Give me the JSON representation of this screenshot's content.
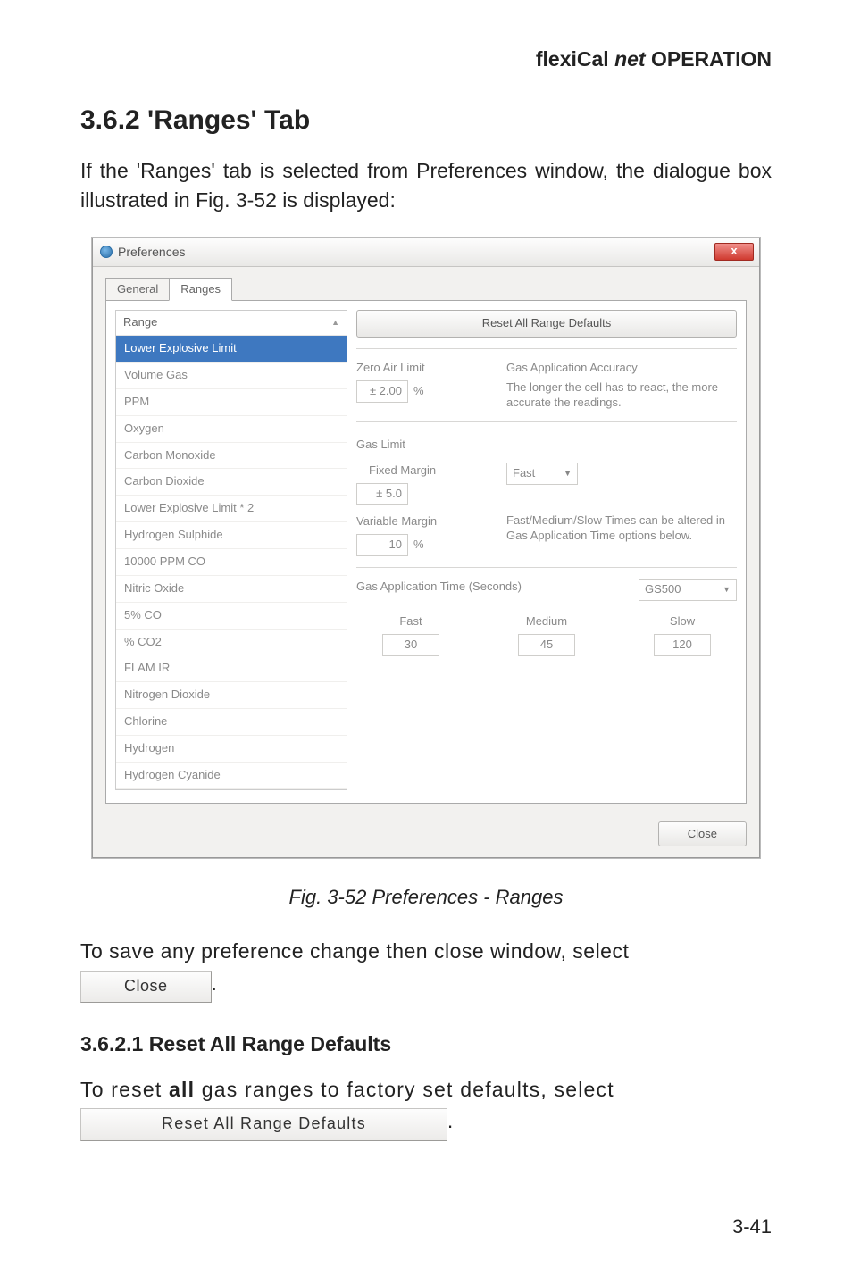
{
  "header": {
    "brand": "flexiCal ",
    "ital": "net",
    "rest": " OPERATION"
  },
  "section_title": "3.6.2  'Ranges' Tab",
  "intro": "If the 'Ranges' tab is selected from Preferences window, the dialogue box illustrated in Fig. 3-52 is displayed:",
  "window": {
    "title": "Preferences",
    "close_x": "x",
    "tabs": {
      "general": "General",
      "ranges": "Ranges"
    },
    "list": {
      "header": "Range",
      "items": [
        "Lower Explosive Limit",
        "Volume Gas",
        "PPM",
        "Oxygen",
        "Carbon Monoxide",
        "Carbon Dioxide",
        "Lower Explosive Limit * 2",
        "Hydrogen Sulphide",
        "10000 PPM CO",
        "Nitric Oxide",
        "5% CO",
        "% CO2",
        "FLAM IR",
        "Nitrogen Dioxide",
        "Chlorine",
        "Hydrogen",
        "Hydrogen Cyanide"
      ]
    },
    "right": {
      "reset_btn": "Reset All Range Defaults",
      "zero_air_label": "Zero Air Limit",
      "zero_air_value": "± 2.00",
      "pct": "%",
      "accuracy_label": "Gas Application Accuracy",
      "accuracy_desc": "The longer the cell has to react, the more accurate the readings.",
      "gas_limit_label": "Gas Limit",
      "fixed_margin_label": "Fixed Margin",
      "fixed_margin_value": "± 5.0",
      "variable_margin_label": "Variable Margin",
      "variable_margin_value": "10",
      "speed_desc": "Fast/Medium/Slow Times can be altered in Gas Application Time options below.",
      "speed_value": "Fast",
      "gatime_label": "Gas Application Time (Seconds)",
      "gs_value": "GS500",
      "col_fast": "Fast",
      "col_medium": "Medium",
      "col_slow": "Slow",
      "val_fast": "30",
      "val_medium": "45",
      "val_slow": "120"
    },
    "footer": {
      "close": "Close"
    }
  },
  "figure_caption": "Fig. 3-52  Preferences - Ranges",
  "save_line": "To save any preference change then close window, select",
  "inline_close": "Close",
  "sub2_title": "3.6.2.1  Reset All Range Defaults",
  "reset_line_1": "To reset ",
  "reset_bold": "all",
  "reset_line_2": " gas ranges to factory set defaults, select",
  "inline_reset": "Reset All Range Defaults",
  "page_num": "3-41"
}
